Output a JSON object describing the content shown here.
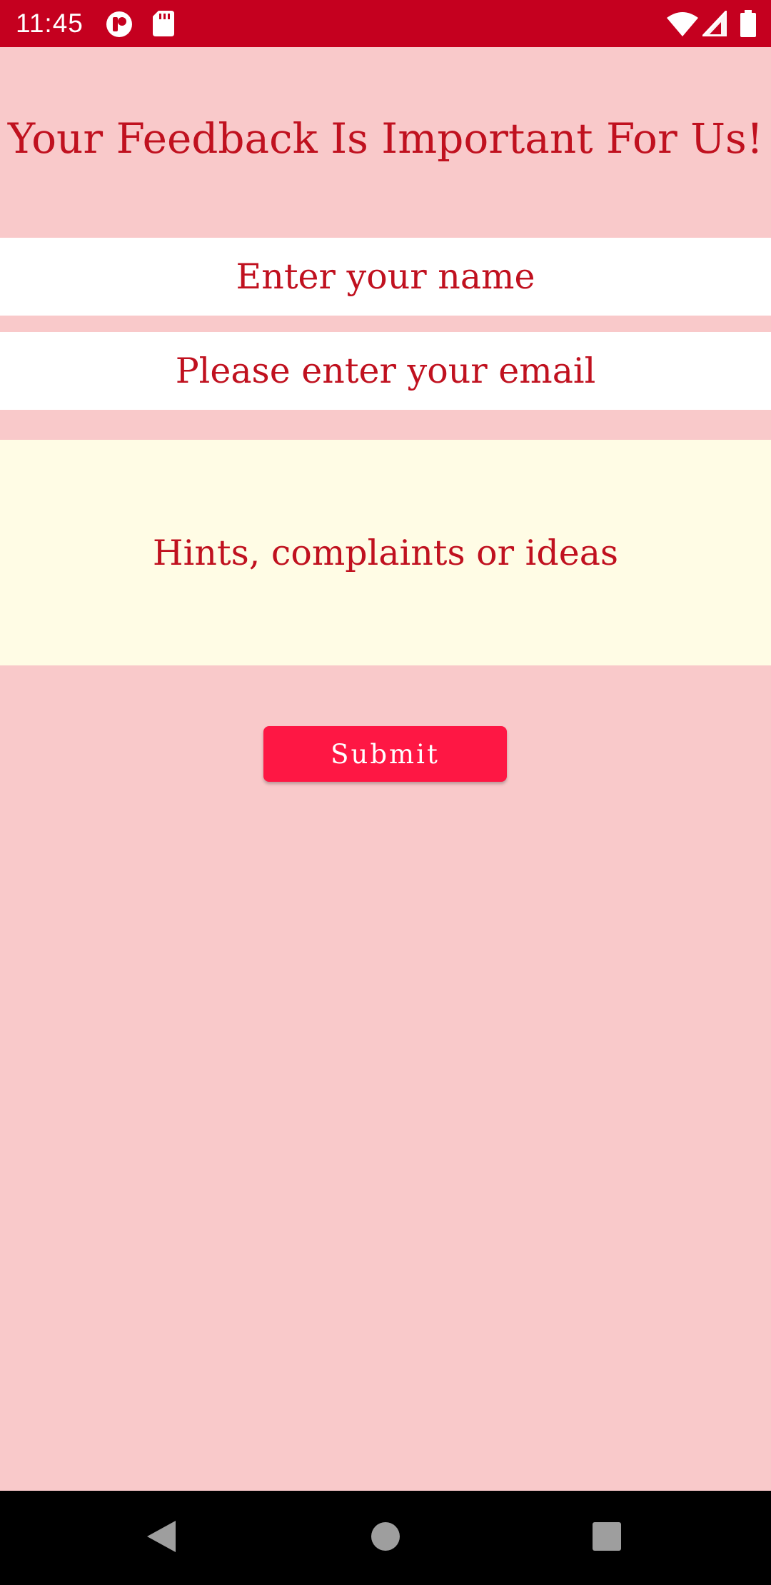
{
  "status_bar": {
    "time": "11:45",
    "icons": [
      "app-notification-icon",
      "sd-card-icon",
      "wifi-icon",
      "signal-icon",
      "battery-icon"
    ],
    "background": "#c5001f"
  },
  "form": {
    "title": "Your Feedback Is Important For Us!",
    "name_placeholder": "Enter your name",
    "email_placeholder": "Please enter your email",
    "message_placeholder": "Hints, complaints or ideas",
    "submit_label": "Submit"
  },
  "nav_bar": {
    "buttons": [
      "back-icon",
      "home-icon",
      "recents-icon"
    ]
  },
  "colors": {
    "background": "#f9c9ca",
    "text": "#c0111f",
    "message_background": "#fffce5",
    "button": "#fe1744"
  }
}
